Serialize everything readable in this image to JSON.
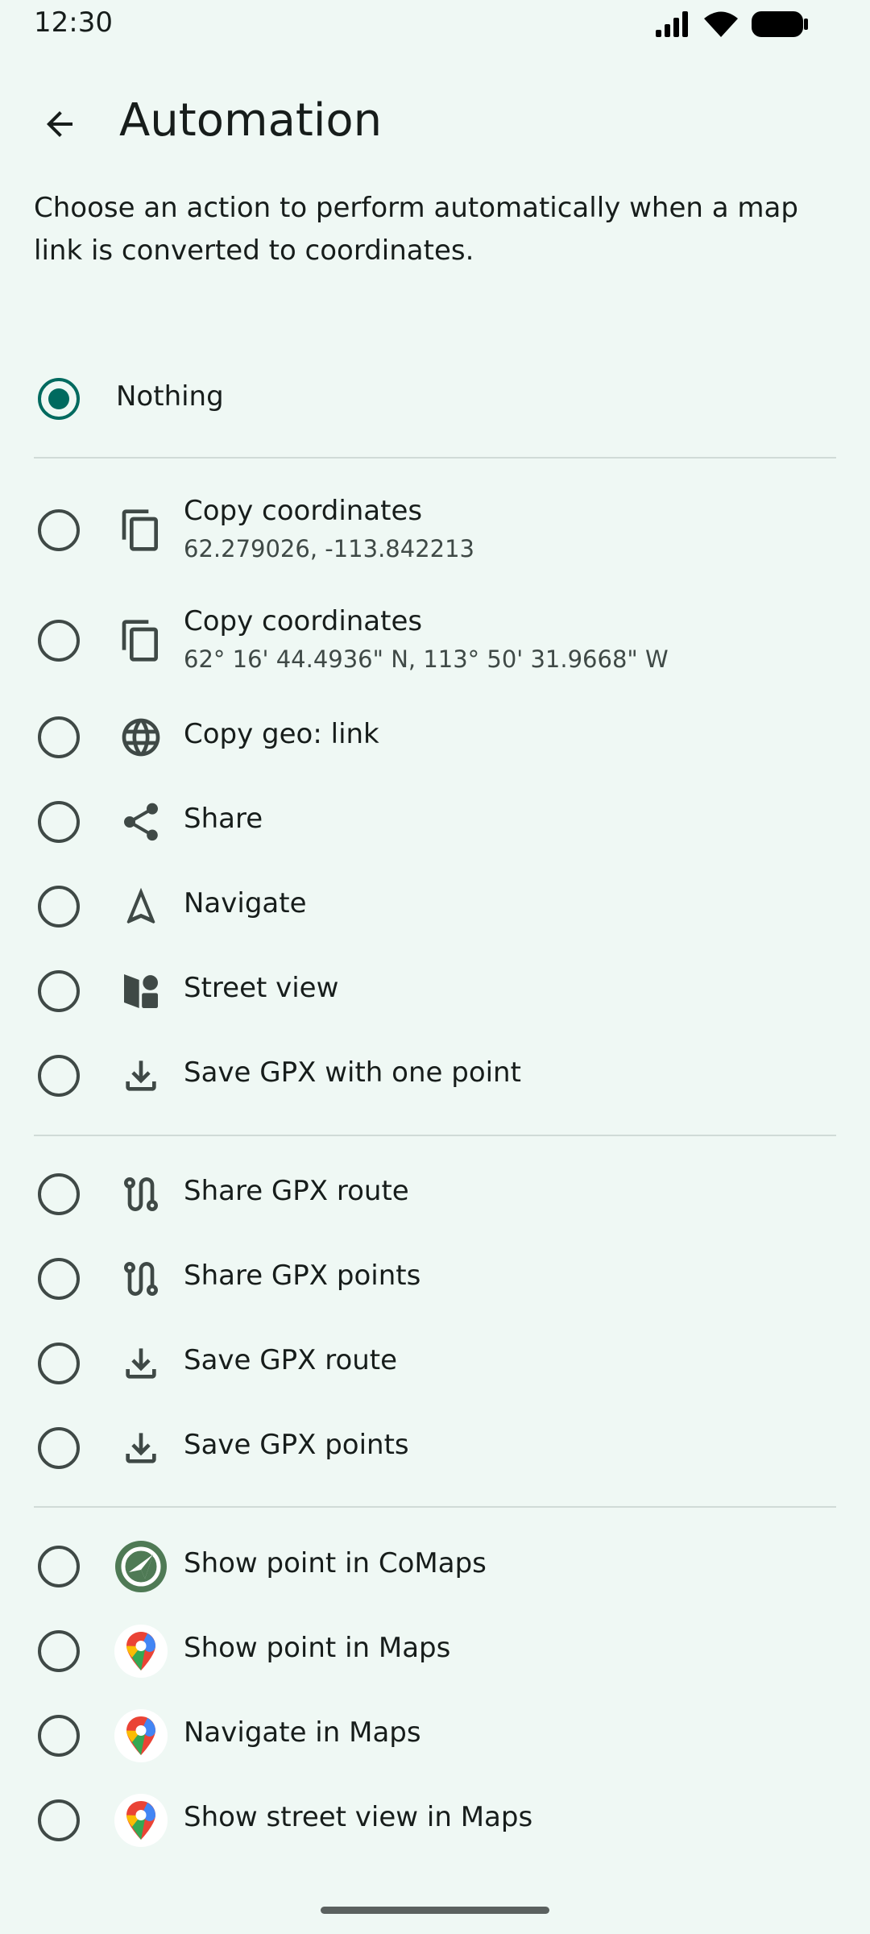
{
  "status": {
    "time": "12:30"
  },
  "header": {
    "title": "Automation"
  },
  "description": "Choose an action to perform automatically when a map link is converted to coordinates.",
  "options": {
    "nothing": {
      "label": "Nothing",
      "selected": true
    },
    "copy_decimal": {
      "label": "Copy coordinates",
      "sub": "62.279026, -113.842213",
      "icon": "copy-icon"
    },
    "copy_dms": {
      "label": "Copy coordinates",
      "sub": "62° 16' 44.4936\" N, 113° 50' 31.9668\" W",
      "icon": "copy-icon"
    },
    "copy_geo": {
      "label": "Copy geo: link",
      "icon": "globe-icon"
    },
    "share": {
      "label": "Share",
      "icon": "share-icon"
    },
    "navigate": {
      "label": "Navigate",
      "icon": "navigation-arrow-icon"
    },
    "street_view": {
      "label": "Street view",
      "icon": "street-view-icon"
    },
    "save_gpx_one": {
      "label": "Save GPX with one point",
      "icon": "download-icon"
    },
    "share_gpx_route": {
      "label": "Share GPX route",
      "icon": "route-icon"
    },
    "share_gpx_points": {
      "label": "Share GPX points",
      "icon": "route-icon"
    },
    "save_gpx_route": {
      "label": "Save GPX route",
      "icon": "download-icon"
    },
    "save_gpx_points": {
      "label": "Save GPX points",
      "icon": "download-icon"
    },
    "comaps_point": {
      "label": "Show point in CoMaps",
      "icon": "comaps-logo-icon"
    },
    "maps_point": {
      "label": "Show point in Maps",
      "icon": "google-maps-logo-icon"
    },
    "maps_navigate": {
      "label": "Navigate in Maps",
      "icon": "google-maps-logo-icon"
    },
    "maps_street_view": {
      "label": "Show street view in Maps",
      "icon": "google-maps-logo-icon"
    }
  },
  "colors": {
    "background": "#eff8f4",
    "accent": "#006a5f",
    "on_surface": "#171d1b",
    "on_surface_variant": "#3f4946",
    "divider": "#d0dbd7"
  }
}
